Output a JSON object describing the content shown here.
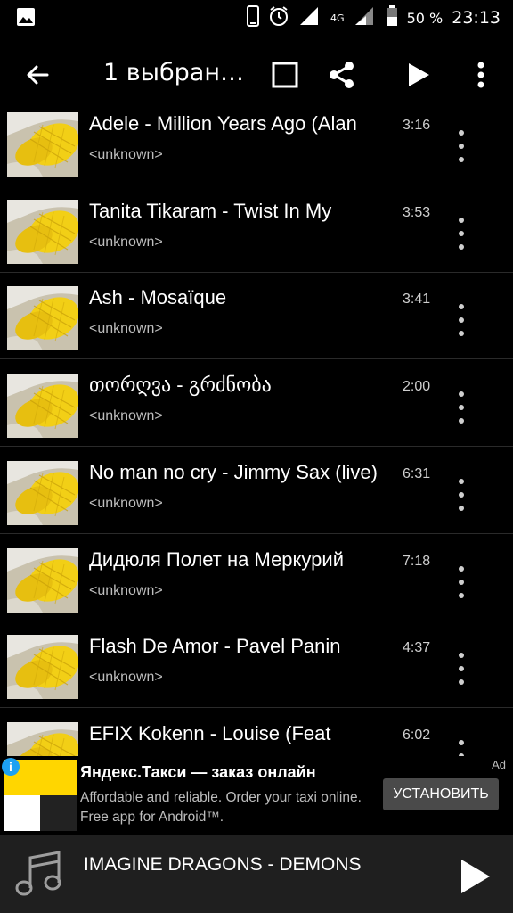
{
  "status_bar": {
    "battery": "50 %",
    "time": "23:13",
    "network": "4G"
  },
  "action_bar": {
    "title": "1 выбранн…"
  },
  "tracks": [
    {
      "title": "Adele - Million Years Ago (Alan",
      "subtitle": "<unknown>",
      "duration": "3:16"
    },
    {
      "title": "Tanita Tikaram - Twist In My",
      "subtitle": "<unknown>",
      "duration": "3:53"
    },
    {
      "title": "Ash - Mosaïque",
      "subtitle": "<unknown>",
      "duration": "3:41"
    },
    {
      "title": "თორღვა - გრძნობა",
      "subtitle": "<unknown>",
      "duration": "2:00"
    },
    {
      "title": "No man no cry - Jimmy Sax (live)",
      "subtitle": "<unknown>",
      "duration": "6:31"
    },
    {
      "title": "Дидюля Полет на Меркурий",
      "subtitle": "<unknown>",
      "duration": "7:18"
    },
    {
      "title": "Flash De Amor - Pavel Panin",
      "subtitle": "<unknown>",
      "duration": "4:37"
    },
    {
      "title": "EFIX Kokenn - Louise (Feat",
      "subtitle": "",
      "duration": "6:02"
    }
  ],
  "ad": {
    "title": "Яндекс.Такси — заказ онлайн",
    "description": "Affordable and reliable. Order your taxi online. Free app for Android™.",
    "tag": "Ad",
    "button": "УСТАНОВИТЬ",
    "info": "i"
  },
  "now_playing": {
    "title": "IMAGINE DRAGONS - DEMONS"
  },
  "colors": {
    "background": "#000000",
    "ad_button": "#4a4a4a",
    "now_playing_bg": "#1f1f1f",
    "thumb_yellow": "#f2cf16"
  }
}
